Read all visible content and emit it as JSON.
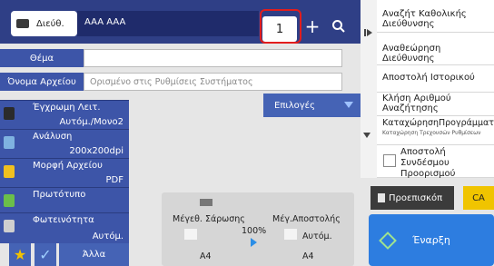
{
  "header": {
    "address_label": "Διεύθ.",
    "address_value": "AAA AAA",
    "count": "1",
    "plus_label": "+"
  },
  "fields": {
    "subject_label": "Θέμα",
    "subject_value": "",
    "filename_label": "Όνομα Αρχείου",
    "filename_placeholder": "Ορισμένο στις Ρυθμίσεις Συστήματος"
  },
  "options_label": "Επιλογές",
  "function_keys": [
    {
      "line1": "Έγχρωμη Λειτ.",
      "line2": "Αυτόμ./Μονο2"
    },
    {
      "line1": "Ανάλυση",
      "line2": "200x200dpi"
    },
    {
      "line1": "Μορφή Αρχείου",
      "line2": "PDF"
    },
    {
      "line1": "Πρωτότυπο",
      "line2": ""
    },
    {
      "line1": "Φωτεινότητα",
      "line2": "Αυτόμ."
    }
  ],
  "bottom_left": {
    "other_label": "Άλλα"
  },
  "scan": {
    "scan_size_label": "Μέγεθ. Σάρωσης",
    "ratio": "100%",
    "send_size_label": "Μέγ.Αποστολής",
    "send_mode": "Αυτόμ.",
    "scan_paper": "A4",
    "send_paper": "A4"
  },
  "side_menu": [
    {
      "label": "Αναζήτ Καθολικής Διεύθυνσης"
    },
    {
      "label": "Αναθεώρηση Διεύθυνσης"
    },
    {
      "label": "Αποστολή Ιστορικού"
    },
    {
      "label": "Κλήση Αριθμού Αναζήτησης"
    },
    {
      "label": "ΚαταχώρησηΠρογράμματος",
      "sub": "Καταχώρηση Τρεχουσών Ρυθμίσεων"
    },
    {
      "label": "Αποστολή Συνδέσμου Προορισμού"
    }
  ],
  "actions": {
    "preview_label": "Προεπισκόπ",
    "ca_label": "CA",
    "start_label": "Έναρξη"
  },
  "colors": {
    "header_bg": "#2f3f86",
    "key_bg": "#3d55a8",
    "start_bg": "#2d7de0",
    "ca_bg": "#f0c400",
    "highlight": "#e21d1d"
  }
}
